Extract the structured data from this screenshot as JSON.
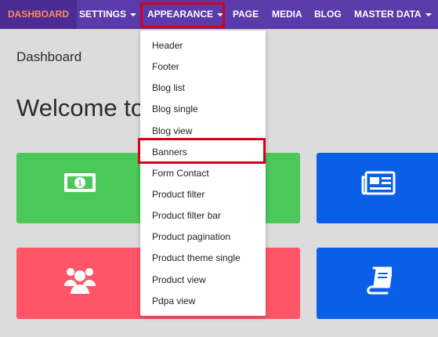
{
  "navbar": {
    "items": [
      {
        "label": "DASHBOARD"
      },
      {
        "label": "SETTINGS"
      },
      {
        "label": "APPEARANCE"
      },
      {
        "label": "PAGE"
      },
      {
        "label": "MEDIA"
      },
      {
        "label": "BLOG"
      },
      {
        "label": "MASTER DATA"
      }
    ]
  },
  "main": {
    "page_title": "Dashboard",
    "welcome_text": "Welcome to"
  },
  "dropdown": {
    "items": [
      {
        "label": "Header"
      },
      {
        "label": "Footer"
      },
      {
        "label": "Blog list"
      },
      {
        "label": "Blog single"
      },
      {
        "label": "Blog view"
      },
      {
        "label": "Banners"
      },
      {
        "label": "Form Contact"
      },
      {
        "label": "Product filter"
      },
      {
        "label": "Product filter bar"
      },
      {
        "label": "Product pagination"
      },
      {
        "label": "Product theme single"
      },
      {
        "label": "Product view"
      },
      {
        "label": "Pdpa view"
      }
    ]
  },
  "cards": [
    {
      "icon": "money-icon",
      "color": "#4cc85a"
    },
    {
      "icon": "newspaper-icon",
      "color": "#0a5fe8"
    },
    {
      "icon": "users-icon",
      "color": "#ff5566"
    },
    {
      "icon": "book-icon",
      "color": "#0a5fe8"
    }
  ],
  "colors": {
    "navbar_bg": "#5b3aaa",
    "active_nav_text": "#ff8a5c",
    "highlight": "#d6001c",
    "page_bg": "#dcdcdc"
  }
}
